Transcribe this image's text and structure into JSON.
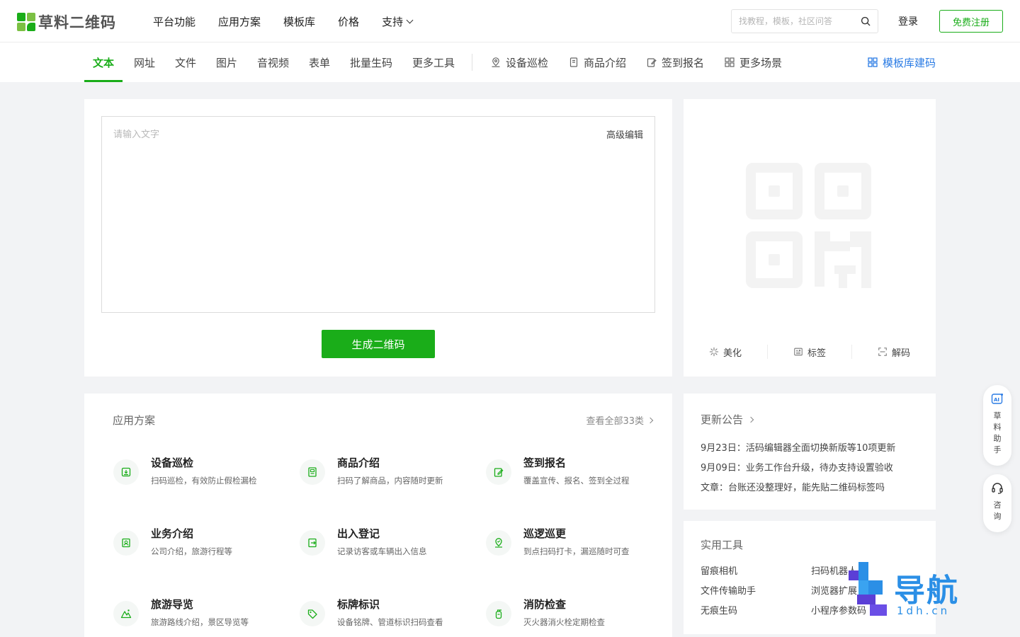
{
  "brand": {
    "name": "草料二维码"
  },
  "main_nav": [
    {
      "label": "平台功能"
    },
    {
      "label": "应用方案"
    },
    {
      "label": "模板库"
    },
    {
      "label": "价格"
    },
    {
      "label": "支持"
    }
  ],
  "search": {
    "placeholder": "找教程，模板，社区问答"
  },
  "auth": {
    "login": "登录",
    "register": "免费注册"
  },
  "tabs": [
    {
      "label": "文本",
      "active": true
    },
    {
      "label": "网址"
    },
    {
      "label": "文件"
    },
    {
      "label": "图片"
    },
    {
      "label": "音视频"
    },
    {
      "label": "表单"
    },
    {
      "label": "批量生码"
    },
    {
      "label": "更多工具"
    }
  ],
  "scenes": [
    {
      "label": "设备巡检",
      "icon": "map-pin-icon"
    },
    {
      "label": "商品介绍",
      "icon": "document-icon"
    },
    {
      "label": "签到报名",
      "icon": "edit-icon"
    },
    {
      "label": "更多场景",
      "icon": "grid-icon"
    }
  ],
  "template_link": {
    "label": "模板库建码",
    "icon": "grid-icon"
  },
  "editor": {
    "placeholder": "请输入文字",
    "advanced_label": "高级编辑",
    "generate_label": "生成二维码"
  },
  "qr_tools": [
    {
      "label": "美化",
      "icon": "sparkle-icon"
    },
    {
      "label": "标签",
      "icon": "label-icon"
    },
    {
      "label": "解码",
      "icon": "scan-icon"
    }
  ],
  "solutions": {
    "title": "应用方案",
    "view_all": "查看全部33类",
    "items": [
      {
        "title": "设备巡检",
        "desc": "扫码巡检，有效防止假检漏检",
        "icon": "inspection-icon"
      },
      {
        "title": "商品介绍",
        "desc": "扫码了解商品，内容随时更新",
        "icon": "product-icon"
      },
      {
        "title": "签到报名",
        "desc": "覆盖宣传、报名、签到全过程",
        "icon": "signup-icon"
      },
      {
        "title": "业务介绍",
        "desc": "公司介绍，旅游行程等",
        "icon": "business-icon"
      },
      {
        "title": "出入登记",
        "desc": "记录访客或车辆出入信息",
        "icon": "entry-icon"
      },
      {
        "title": "巡逻巡更",
        "desc": "到点扫码打卡，漏巡随时可查",
        "icon": "patrol-icon"
      },
      {
        "title": "旅游导览",
        "desc": "旅游路线介绍，景区导览等",
        "icon": "mountain-icon"
      },
      {
        "title": "标牌标识",
        "desc": "设备铭牌、管道标识扫码查看",
        "icon": "tag-icon"
      },
      {
        "title": "消防检查",
        "desc": "灭火器消火栓定期检查",
        "icon": "extinguisher-icon"
      }
    ]
  },
  "news": {
    "title": "更新公告",
    "items": [
      "9月23日：活码编辑器全面切换新版等10项更新",
      "9月09日：业务工作台升级，待办支持设置验收",
      "文章：台账还没整理好，能先贴二维码标签吗"
    ]
  },
  "tools": {
    "title": "实用工具",
    "items": [
      "留痕相机",
      "扫码机器人",
      "文件传输助手",
      "浏览器扩展",
      "无痕生码",
      "小程序参数码"
    ]
  },
  "float": {
    "assistant": "草料助手",
    "consult": "咨询"
  },
  "watermark": {
    "text": "导航",
    "sub": "1dh.cn"
  },
  "colors": {
    "accent": "#1aad19",
    "link": "#2a7be4"
  }
}
